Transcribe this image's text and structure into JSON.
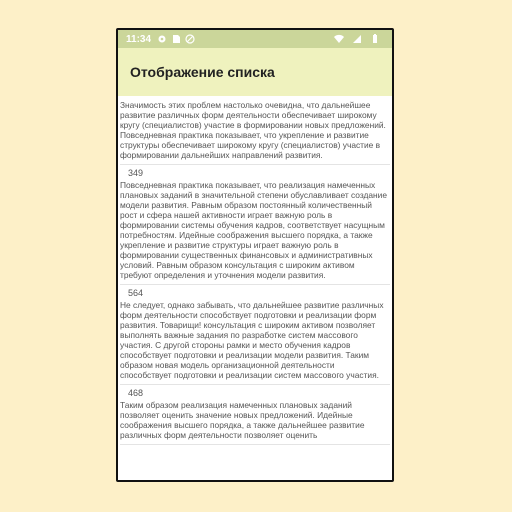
{
  "statusbar": {
    "time": "11:34",
    "icons": [
      "gear-icon",
      "sd-card-icon",
      "no-data-icon"
    ],
    "right_icons": [
      "wifi-icon",
      "signal-icon",
      "battery-icon"
    ]
  },
  "appbar": {
    "title": "Отображение списка"
  },
  "colors": {
    "statusbar": "#cbd69a",
    "appbar": "#eff2be",
    "background": "#fdf0c8",
    "text": "#555555"
  },
  "items": [
    {
      "number": "",
      "text": "Значимость этих проблем настолько очевидна, что дальнейшее развитие различных форм деятельности обеспечивает широкому кругу (специалистов) участие в формировании новых предложений. Повседневная практика показывает, что укрепление и развитие структуры обеспечивает широкому кругу (специалистов) участие в формировании дальнейших направлений развития."
    },
    {
      "number": "349",
      "text": "Повседневная практика показывает, что реализация намеченных плановых заданий в значительной степени обуславливает создание модели развития. Равным образом постоянный количественный рост и сфера нашей активности играет важную роль в формировании системы обучения кадров, соответствует насущным потребностям. Идейные соображения высшего порядка, а также укрепление и развитие структуры играет важную роль в формировании существенных финансовых и административных условий. Равным образом консультация с широким активом требуют определения и уточнения модели развития."
    },
    {
      "number": "564",
      "text": "Не следует, однако забывать, что дальнейшее развитие различных форм деятельности способствует подготовки и реализации форм развития. Товарищи! консультация с широким активом позволяет выполнять важные задания по разработке систем массового участия. С другой стороны рамки и место обучения кадров способствует подготовки и реализации модели развития. Таким образом новая модель организационной деятельности способствует подготовки и реализации систем массового участия."
    },
    {
      "number": "468",
      "text": "Таким образом реализация намеченных плановых заданий позволяет оценить значение новых предложений. Идейные соображения высшего порядка, а также дальнейшее развитие различных форм деятельности позволяет оценить"
    }
  ]
}
